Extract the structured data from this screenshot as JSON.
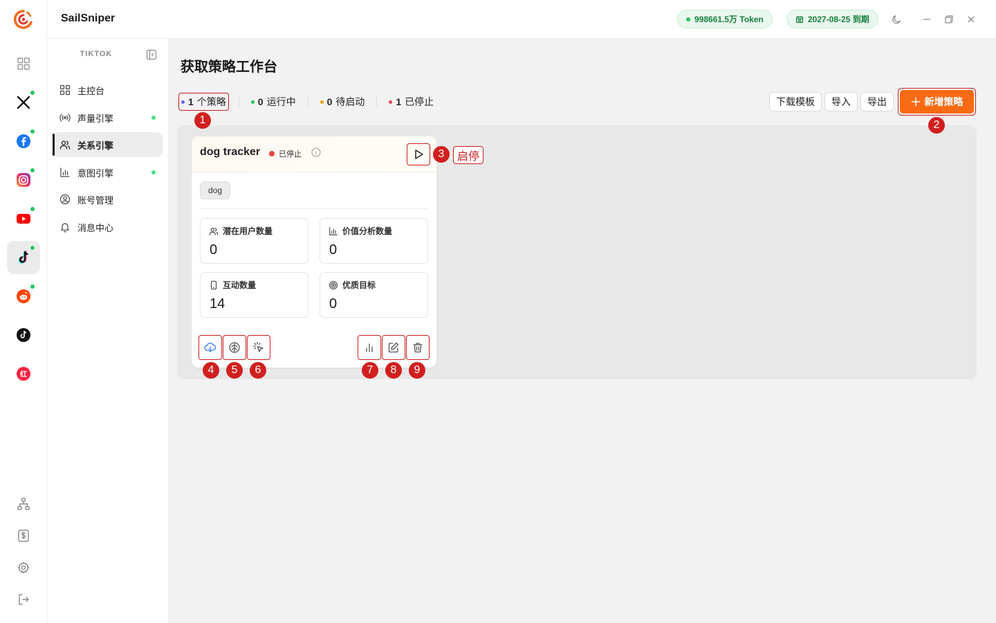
{
  "app": {
    "name": "SailSniper",
    "token_text": "998661.5万 Token",
    "expire_text": "2027-08-25 到期",
    "accent": "#f96a14"
  },
  "rail": {
    "items": [
      {
        "name": "dashboard-grid",
        "icon": "grid-icon"
      },
      {
        "name": "x",
        "icon": "x-logo-icon"
      },
      {
        "name": "facebook",
        "icon": "facebook-logo-icon"
      },
      {
        "name": "instagram",
        "icon": "instagram-logo-icon"
      },
      {
        "name": "youtube",
        "icon": "youtube-logo-icon"
      },
      {
        "name": "tiktok",
        "icon": "tiktok-logo-icon"
      },
      {
        "name": "reddit",
        "icon": "reddit-logo-icon"
      },
      {
        "name": "tiktok-alt",
        "icon": "tiktok-logo-icon"
      },
      {
        "name": "xiaohongshu",
        "icon": "xiaohongshu-logo-icon"
      }
    ],
    "xhs_label": "红"
  },
  "subnav": {
    "title": "TIKTOK",
    "items": [
      {
        "label": "主控台",
        "icon": "grid-icon"
      },
      {
        "label": "声量引擎",
        "icon": "broadcast-icon"
      },
      {
        "label": "关系引擎",
        "icon": "users-icon"
      },
      {
        "label": "意图引擎",
        "icon": "bar-chart-icon"
      },
      {
        "label": "账号管理",
        "icon": "user-circle-icon"
      },
      {
        "label": "消息中心",
        "icon": "bell-icon"
      }
    ]
  },
  "main": {
    "title": "获取策略工作台",
    "stats": [
      {
        "count": "1",
        "label": "个策略",
        "color": "#6366f1"
      },
      {
        "count": "0",
        "label": "运行中",
        "color": "#22c55e"
      },
      {
        "count": "0",
        "label": "待启动",
        "color": "#f59e0b"
      },
      {
        "count": "1",
        "label": "已停止",
        "color": "#ef4444"
      }
    ],
    "buttons": {
      "download_template": "下载模板",
      "import": "导入",
      "export": "导出",
      "add_strategy": "新增策略"
    }
  },
  "card": {
    "name": "dog tracker",
    "status": "已停止",
    "tag": "dog",
    "metrics": [
      {
        "label": "潜在用户数量",
        "value": "0",
        "icon": "users-icon"
      },
      {
        "label": "价值分析数量",
        "value": "0",
        "icon": "bar-chart-icon"
      },
      {
        "label": "互动数量",
        "value": "14",
        "icon": "phone-icon"
      },
      {
        "label": "优质目标",
        "value": "0",
        "icon": "target-icon"
      }
    ]
  },
  "annotations": {
    "markers": [
      "1",
      "2",
      "3",
      "4",
      "5",
      "6",
      "7",
      "8",
      "9"
    ],
    "callout": "启停"
  }
}
